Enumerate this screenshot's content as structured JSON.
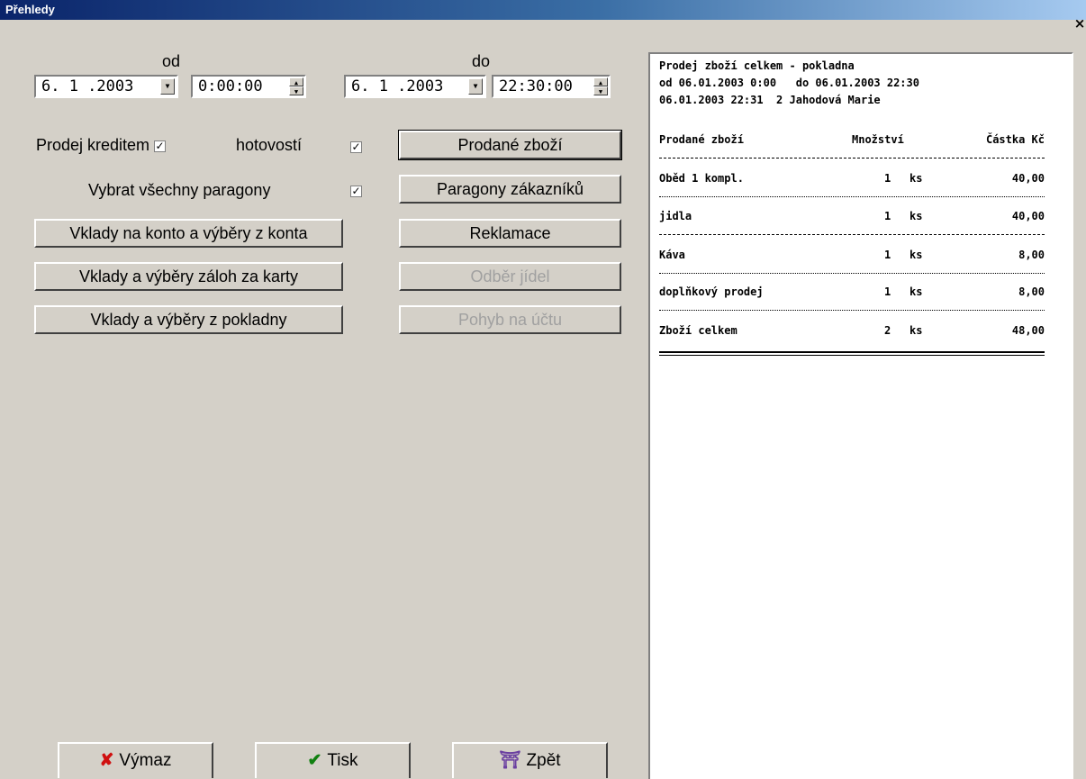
{
  "window": {
    "title": "Přehledy",
    "close_label": "×"
  },
  "dates": {
    "from_label": "od",
    "to_label": "do",
    "from_date": "6. 1 .2003",
    "from_time": "0:00:00",
    "to_date": "6. 1 .2003",
    "to_time": "22:30:00"
  },
  "options": {
    "credit_label": "Prodej kreditem",
    "cash_label": "hotovostí",
    "all_receipts_label": "Vybrat všechny paragony",
    "check_mark": "✓"
  },
  "buttons": {
    "deposits_account": "Vklady na konto a výběry z konta",
    "deposits_cards": "Vklady a výběry záloh za karty",
    "deposits_register": "Vklady a výběry z pokladny",
    "sold_goods": "Prodané zboží",
    "customer_receipts": "Paragony zákazníků",
    "complaints": "Reklamace",
    "meal_pickup": "Odběr jídel",
    "account_movement": "Pohyb na účtu"
  },
  "bottom": {
    "delete": "Výmaz",
    "print": "Tisk",
    "back": "Zpět"
  },
  "report": {
    "header1": "Prodej zboží celkem - pokladna",
    "header2": "od 06.01.2003 0:00   do 06.01.2003 22:30",
    "header3": "06.01.2003 22:31  2 Jahodová Marie",
    "col_item": "Prodané zboží",
    "col_qty": "Množství",
    "col_amount": "Částka Kč",
    "rows": [
      {
        "name": "Oběd 1 kompl.",
        "qty": "1",
        "unit": "ks",
        "amount": "40,00"
      },
      {
        "name": "jidla",
        "qty": "1",
        "unit": "ks",
        "amount": "40,00"
      },
      {
        "name": "Káva",
        "qty": "1",
        "unit": "ks",
        "amount": "8,00"
      },
      {
        "name": "doplňkový prodej",
        "qty": "1",
        "unit": "ks",
        "amount": "8,00"
      },
      {
        "name": "Zboží celkem",
        "qty": "2",
        "unit": "ks",
        "amount": "48,00"
      }
    ]
  }
}
